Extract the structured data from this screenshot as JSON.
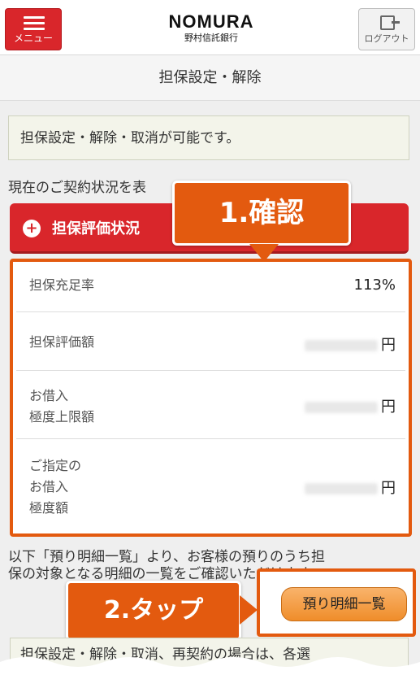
{
  "header": {
    "menu_label": "メニュー",
    "logo_text": "NOMURA",
    "logo_subtext": "野村信託銀行",
    "logout_label": "ログアウト"
  },
  "page": {
    "title": "担保設定・解除"
  },
  "notice": {
    "text": "担保設定・解除・取消が可能です。"
  },
  "contract": {
    "text": "現在のご契約状況を表"
  },
  "collateral_status_button": {
    "label": "担保評価状況"
  },
  "table": {
    "rows": [
      {
        "label_line1": "担保充足率",
        "label_line2": "",
        "label_line3": "",
        "value": "113%"
      },
      {
        "label_line1": "担保評価額",
        "label_line2": "",
        "label_line3": "",
        "value": "円"
      },
      {
        "label_line1": "お借入",
        "label_line2": "極度上限額",
        "label_line3": "",
        "value": "円"
      },
      {
        "label_line1": "ご指定の",
        "label_line2": "お借入",
        "label_line3": "極度額",
        "value": "円"
      }
    ]
  },
  "description": {
    "line1": "以下「預り明細一覧」より、お客様の預りのうち担",
    "line2": "保の対象となる明細の一覧をご確認いただけます。"
  },
  "detail_button": {
    "label": "預り明細一覧"
  },
  "callouts": {
    "confirm": "1.確認",
    "tap": "2.タップ"
  },
  "footer": {
    "text": "担保設定・解除・取消、再契約の場合は、各選"
  },
  "colors": {
    "accent_red": "#d9262b",
    "callout_orange": "#e35a0f",
    "button_orange": "#ef8d2a"
  }
}
